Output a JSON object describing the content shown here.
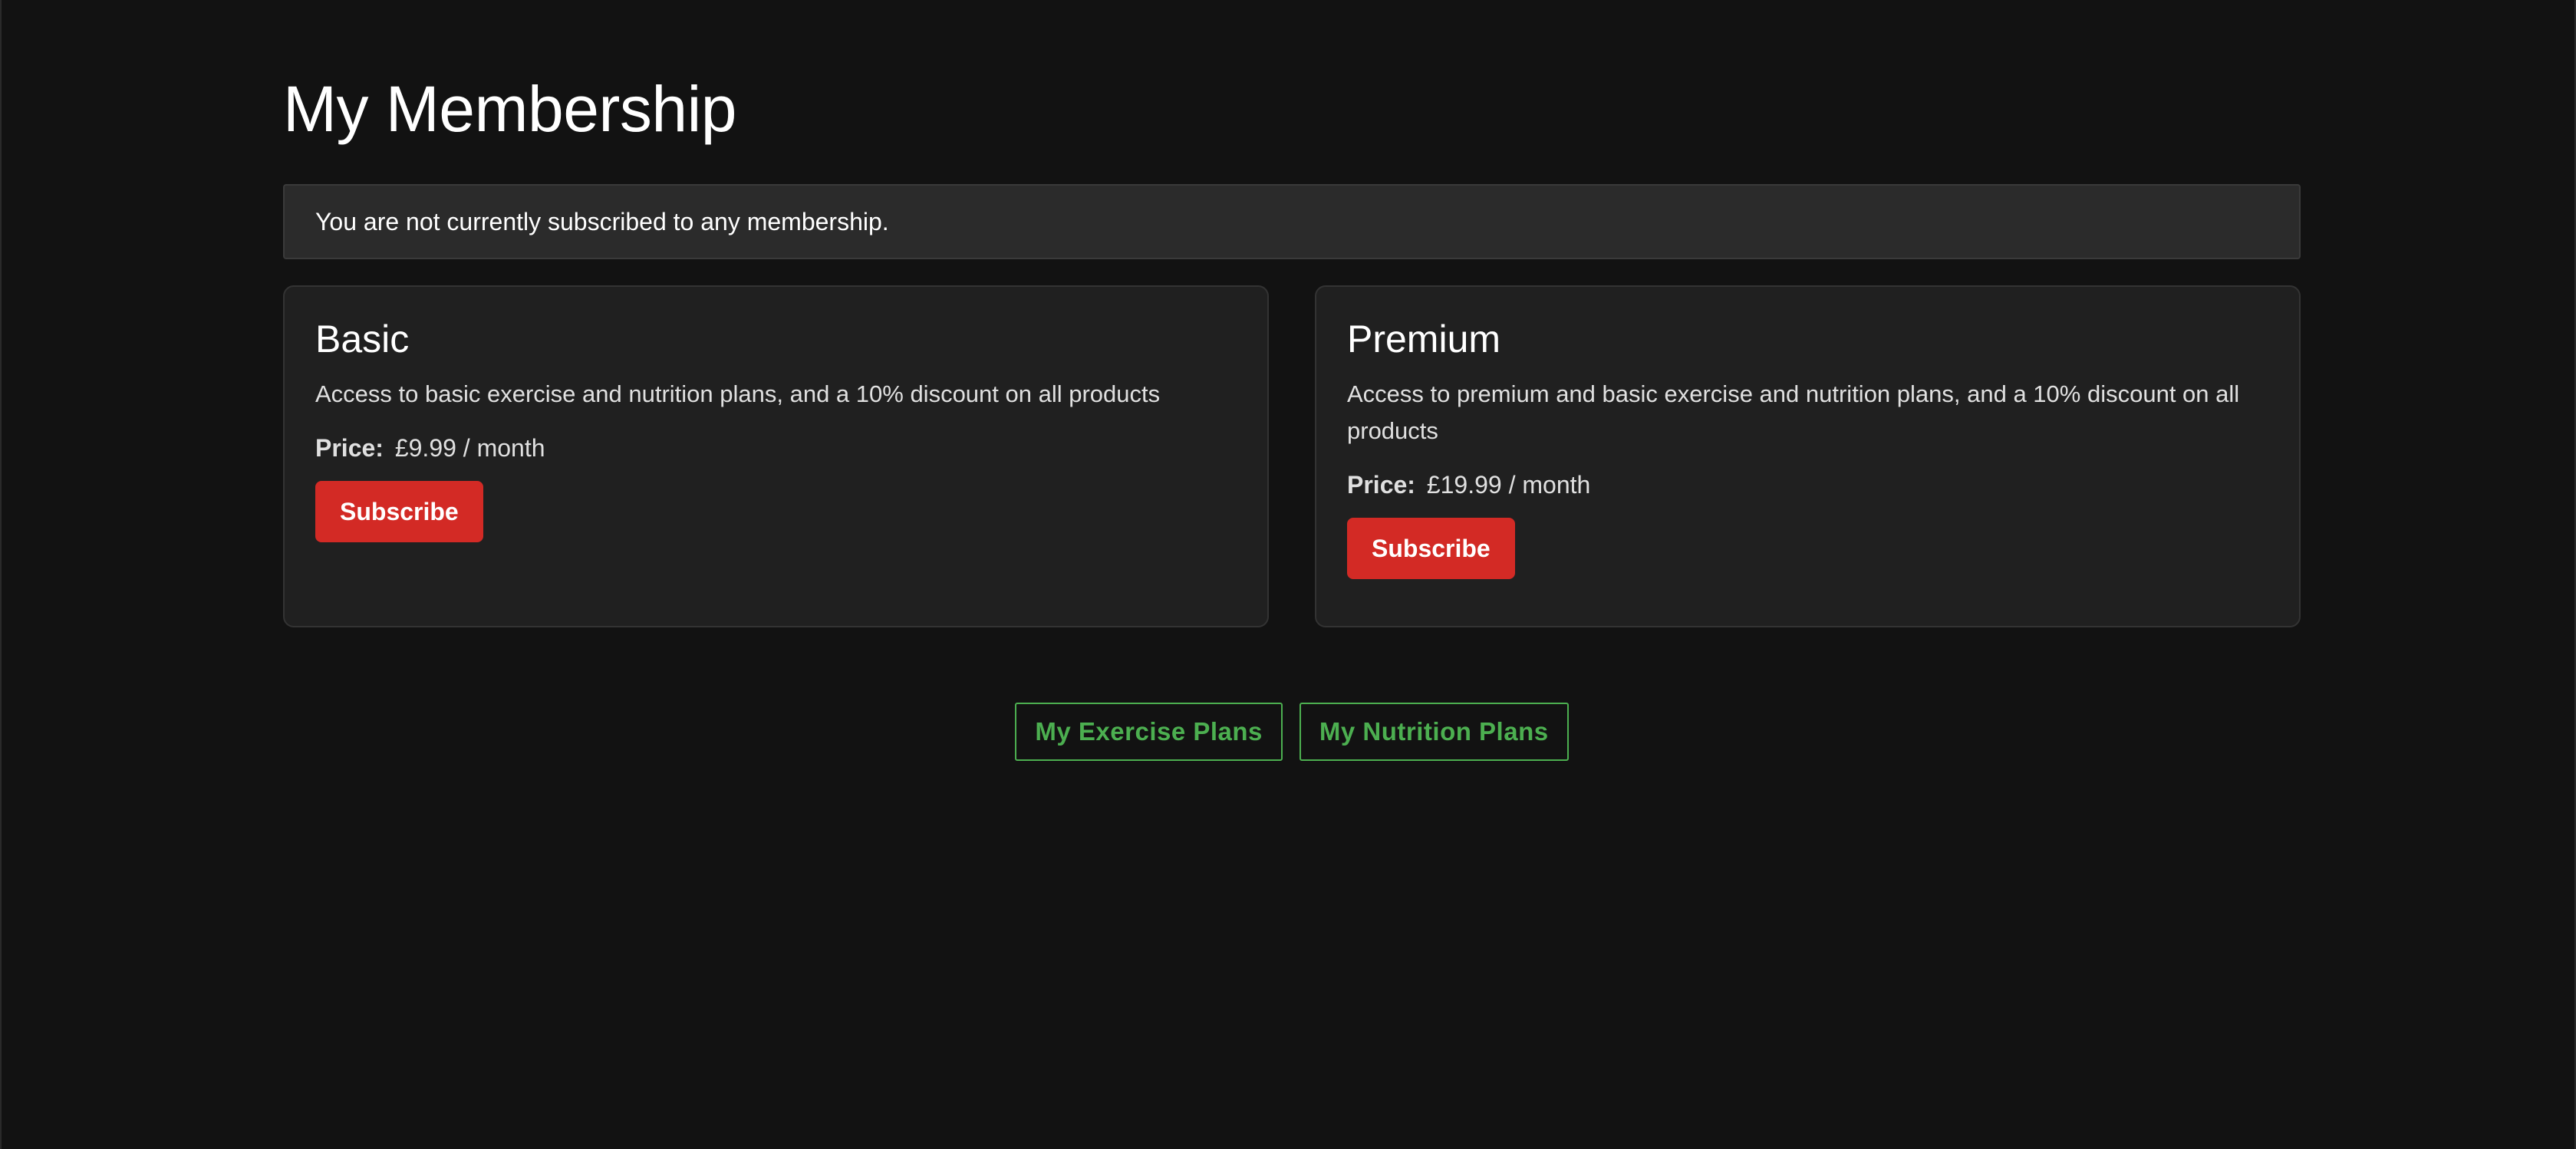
{
  "page": {
    "title": "My Membership"
  },
  "notice": {
    "text": "You are not currently subscribed to any membership."
  },
  "plans": [
    {
      "name": "Basic",
      "description": "Access to basic exercise and nutrition plans, and a 10% discount on all products",
      "price_label": "Price:",
      "price_value": "£9.99 / month",
      "button_label": "Subscribe"
    },
    {
      "name": "Premium",
      "description": "Access to premium and basic exercise and nutrition plans, and a 10% discount on all products",
      "price_label": "Price:",
      "price_value": "£19.99 / month",
      "button_label": "Subscribe"
    }
  ],
  "nav": {
    "exercise_label": "My Exercise Plans",
    "nutrition_label": "My Nutrition Plans"
  },
  "colors": {
    "background": "#121212",
    "card": "#202020",
    "notice": "#2b2b2b",
    "subscribe_accent": "#d32a25",
    "link_accent": "#4caf50"
  }
}
